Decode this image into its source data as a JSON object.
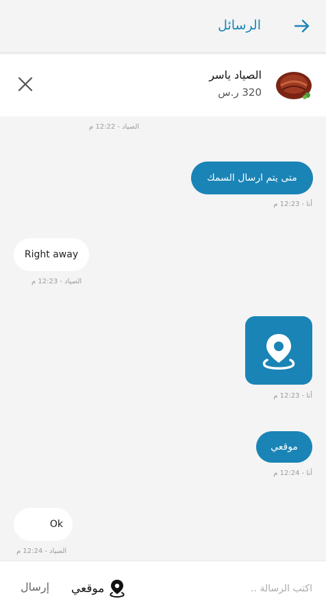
{
  "header": {
    "title": "الرسائل"
  },
  "product": {
    "name": "الصياد ياسر",
    "price": "320 ر.س"
  },
  "messages": {
    "m0_meta": "الصياد - 12:22 م",
    "m1_text": "متى يتم ارسال السمك",
    "m1_meta": "أنا - 12:23 م",
    "m2_text": "Right away",
    "m2_meta": "الصياد - 12:23 م",
    "m3_meta": "أنا - 12:23 م",
    "m4_text": "موقعي",
    "m4_meta": "أنا - 12:24 م",
    "m5_text": "Ok",
    "m5_meta": "الصياد - 12:24 م"
  },
  "composer": {
    "placeholder": "اكتب الرسالة ..",
    "location_label": "موقعي",
    "send_label": "إرسال"
  },
  "colors": {
    "accent": "#1a84b6",
    "background": "#f4f4f4"
  }
}
